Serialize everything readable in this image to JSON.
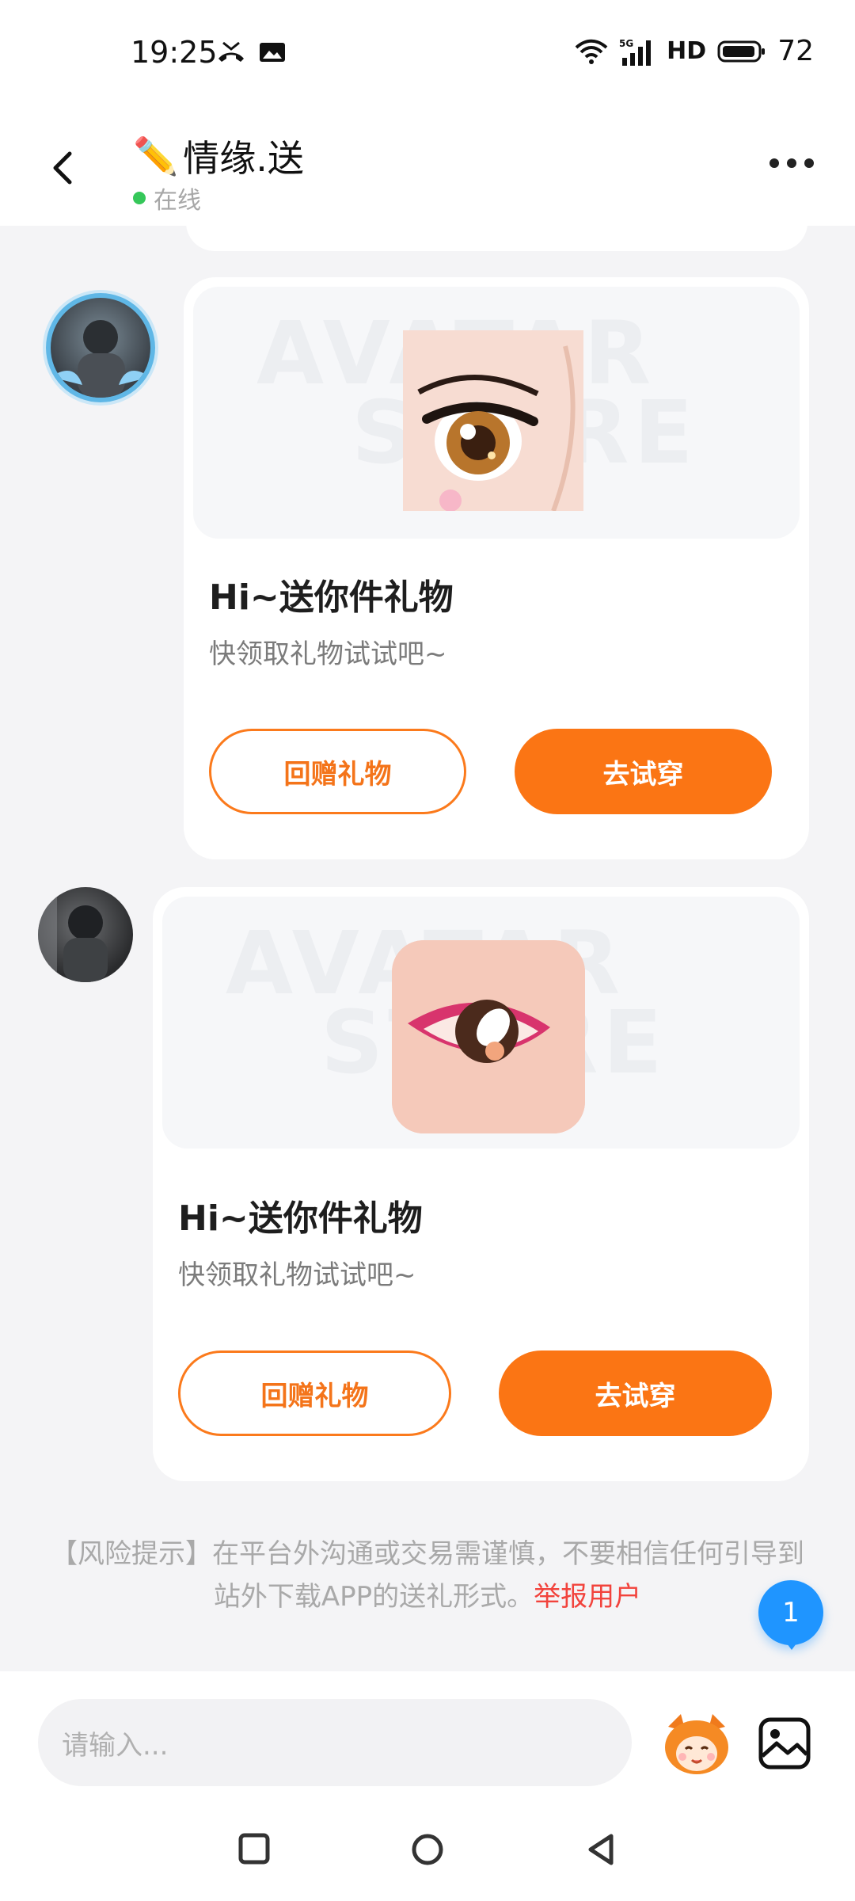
{
  "status_bar": {
    "time": "19:25",
    "battery": "72",
    "network": "5G",
    "hd": "HD"
  },
  "header": {
    "title_emoji": "✏️",
    "title": "情缘.送",
    "status": "在线"
  },
  "messages": [
    {
      "title": "Hi~送你件礼物",
      "subtitle": "快领取礼物试试吧~",
      "return_gift_label": "回赠礼物",
      "try_on_label": "去试穿",
      "watermark_line1": "AVATAR",
      "watermark_line2": "STORE"
    },
    {
      "title": "Hi~送你件礼物",
      "subtitle": "快领取礼物试试吧~",
      "return_gift_label": "回赠礼物",
      "try_on_label": "去试穿",
      "watermark_line1": "AVATAR",
      "watermark_line2": "STORE"
    }
  ],
  "risk_notice": {
    "text": "【风险提示】在平台外沟通或交易需谨慎，不要相信任何引导到站外下载APP的送礼形式。",
    "report_link": "举报用户"
  },
  "unread_badge": "1",
  "input": {
    "placeholder": "请输入..."
  },
  "colors": {
    "accent": "#fb7514",
    "online": "#35c759",
    "badge": "#1f95ff",
    "report": "#f2433c"
  }
}
